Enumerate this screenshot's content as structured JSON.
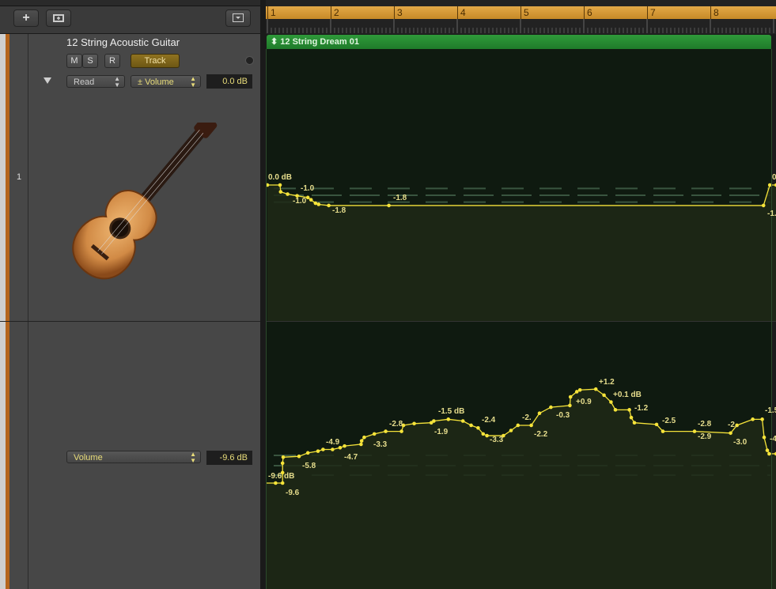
{
  "toolbar": {
    "add_icon": "plus-icon",
    "folder_icon": "add-folder-icon",
    "menu_icon": "dropdown-icon"
  },
  "track": {
    "number": "1",
    "name": "12 String Acoustic Guitar",
    "mute": "M",
    "solo": "S",
    "record": "R",
    "track_button": "Track",
    "automation_mode": "Read",
    "parameter": "± Volume",
    "parameter_value": "0.0 dB",
    "lane2_parameter": "Volume",
    "lane2_value": "-9.6 dB",
    "icon": "acoustic-guitar-icon"
  },
  "ruler": {
    "bars": [
      "1",
      "2",
      "3",
      "4",
      "5",
      "6",
      "7",
      "8"
    ],
    "color": "#d99a35"
  },
  "region": {
    "name": "12 String Dream 01",
    "color": "#23862e"
  },
  "automation": {
    "curve_color": "#f5e33a",
    "lane1": {
      "points": [
        [
          1.0,
          0
        ],
        [
          1.2,
          0
        ],
        [
          1.21,
          -0.6
        ],
        [
          1.32,
          -0.8
        ],
        [
          1.47,
          -0.95
        ],
        [
          1.64,
          -1.1
        ],
        [
          1.69,
          -1.3
        ],
        [
          1.76,
          -1.6
        ],
        [
          1.81,
          -1.7
        ],
        [
          1.97,
          -1.8
        ],
        [
          2.92,
          -1.8
        ],
        [
          8.84,
          -1.8
        ],
        [
          8.94,
          0
        ],
        [
          9.04,
          0
        ]
      ],
      "labels": [
        "0.0 dB",
        "-1.0",
        "-1.0",
        "-1.8",
        "-1.8",
        "0",
        "-1."
      ]
    },
    "lane2": {
      "points": [
        [
          0.96,
          -9.6
        ],
        [
          1.13,
          -9.6
        ],
        [
          1.24,
          -9.6
        ],
        [
          1.24,
          -8.4
        ],
        [
          1.24,
          -7.3
        ],
        [
          1.25,
          -6.6
        ],
        [
          1.5,
          -6.5
        ],
        [
          1.64,
          -6.1
        ],
        [
          1.8,
          -5.9
        ],
        [
          1.88,
          -5.7
        ],
        [
          2.03,
          -5.7
        ],
        [
          2.15,
          -5.5
        ],
        [
          2.22,
          -5.3
        ],
        [
          2.48,
          -5.1
        ],
        [
          2.49,
          -4.7
        ],
        [
          2.53,
          -4.3
        ],
        [
          2.69,
          -3.9
        ],
        [
          2.87,
          -3.6
        ],
        [
          3.12,
          -3.6
        ],
        [
          3.15,
          -2.9
        ],
        [
          3.32,
          -2.7
        ],
        [
          3.59,
          -2.6
        ],
        [
          3.63,
          -2.4
        ],
        [
          3.86,
          -2.2
        ],
        [
          4.09,
          -2.4
        ],
        [
          4.22,
          -2.9
        ],
        [
          4.33,
          -3.2
        ],
        [
          4.41,
          -3.9
        ],
        [
          4.47,
          -4.1
        ],
        [
          4.73,
          -4.1
        ],
        [
          4.85,
          -3.5
        ],
        [
          4.96,
          -2.9
        ],
        [
          5.17,
          -2.9
        ],
        [
          5.3,
          -1.5
        ],
        [
          5.48,
          -0.8
        ],
        [
          5.78,
          -0.6
        ],
        [
          5.79,
          0.4
        ],
        [
          5.89,
          1.0
        ],
        [
          5.94,
          1.2
        ],
        [
          6.19,
          1.3
        ],
        [
          6.32,
          0.6
        ],
        [
          6.43,
          -0.2
        ],
        [
          6.5,
          -1.1
        ],
        [
          6.72,
          -1.1
        ],
        [
          6.75,
          -2.0
        ],
        [
          6.8,
          -2.6
        ],
        [
          7.15,
          -2.8
        ],
        [
          7.25,
          -3.6
        ],
        [
          7.75,
          -3.6
        ],
        [
          8.32,
          -3.8
        ],
        [
          8.42,
          -2.9
        ],
        [
          8.67,
          -2.2
        ],
        [
          8.82,
          -2.2
        ],
        [
          8.85,
          -4.3
        ],
        [
          8.9,
          -5.8
        ],
        [
          8.93,
          -6.2
        ],
        [
          9.04,
          -6.2
        ]
      ],
      "labels": [
        "-9.6 dB",
        "-9.6",
        "-5.8",
        "-4.9",
        "-4.7",
        "-3.3",
        "-2.8",
        "-1.5 dB",
        "-1.9",
        "-2.4",
        "-3.3",
        "-2.",
        "-2.2",
        "-0.3",
        "+0.9",
        "+1.2",
        "+0.1 dB",
        "-1.2",
        "-2.5",
        "-2.8",
        "-2.9",
        "-2.",
        "-3.0",
        "-1.5",
        "-4"
      ]
    }
  }
}
